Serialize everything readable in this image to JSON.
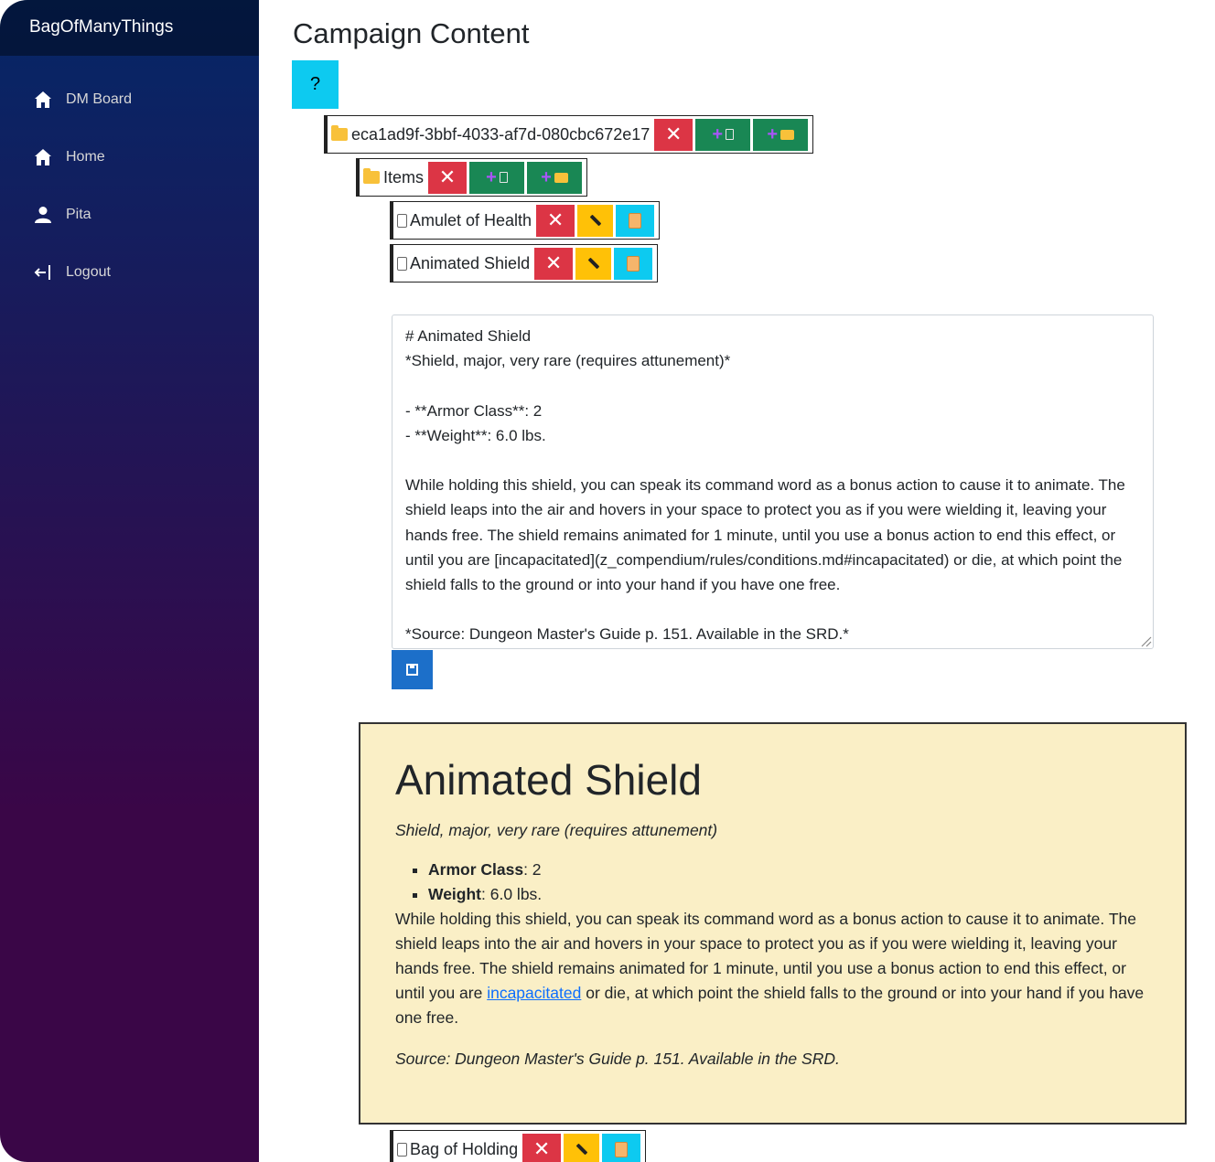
{
  "sidebar": {
    "brand": "BagOfManyThings",
    "items": [
      {
        "label": "DM Board",
        "icon": "home-icon"
      },
      {
        "label": "Home",
        "icon": "home-icon"
      },
      {
        "label": "Pita",
        "icon": "person-icon"
      },
      {
        "label": "Logout",
        "icon": "logout-icon"
      }
    ]
  },
  "main": {
    "title": "Campaign Content",
    "help_label": "?"
  },
  "tree": {
    "root": {
      "label": "eca1ad9f-3bbf-4033-af7d-080cbc672e17"
    },
    "folder": {
      "label": "Items"
    },
    "items": [
      {
        "label": "Amulet of Health"
      },
      {
        "label": "Animated Shield"
      },
      {
        "label": "Bag of Holding"
      }
    ]
  },
  "editor": {
    "value": "# Animated Shield\n*Shield, major, very rare (requires attunement)*\n\n- **Armor Class**: 2\n- **Weight**: 6.0 lbs.\n\nWhile holding this shield, you can speak its command word as a bonus action to cause it to animate. The shield leaps into the air and hovers in your space to protect you as if you were wielding it, leaving your hands free. The shield remains animated for 1 minute, until you use a bonus action to end this effect, or until you are [incapacitated](z_compendium/rules/conditions.md#incapacitated) or die, at which point the shield falls to the ground or into your hand if you have one free.\n\n*Source: Dungeon Master's Guide p. 151. Available in the SRD.*"
  },
  "preview": {
    "title": "Animated Shield",
    "subtitle": "Shield, major, very rare (requires attunement)",
    "props": [
      {
        "key": "Armor Class",
        "value": ": 2"
      },
      {
        "key": "Weight",
        "value": ": 6.0 lbs."
      }
    ],
    "body_before": "While holding this shield, you can speak its command word as a bonus action to cause it to animate. The shield leaps into the air and hovers in your space to protect you as if you were wielding it, leaving your hands free. The shield remains animated for 1 minute, until you use a bonus action to end this effect, or until you are ",
    "link_text": "incapacitated",
    "body_after": " or die, at which point the shield falls to the ground or into your hand if you have one free.",
    "source": "Source: Dungeon Master's Guide p. 151. Available in the SRD."
  },
  "colors": {
    "danger": "#dc3545",
    "success": "#198754",
    "warning": "#ffc107",
    "info": "#0dcaf0",
    "primary": "#1c6fc9",
    "preview_bg": "#faefc6"
  }
}
